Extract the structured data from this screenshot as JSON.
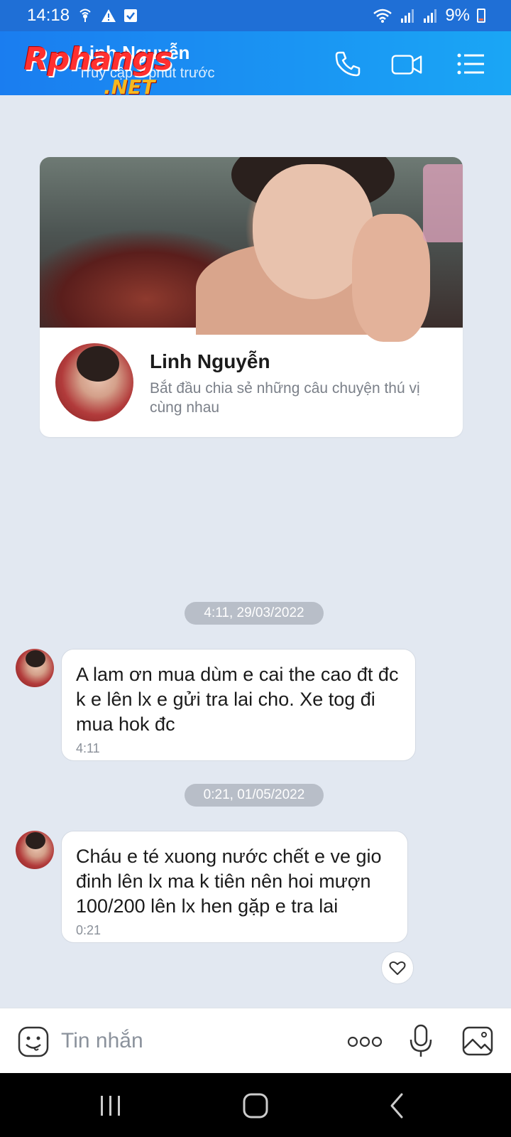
{
  "status_bar": {
    "time": "14:18",
    "battery": "9%",
    "icons": [
      "cast-icon",
      "warning-icon",
      "check-box-icon",
      "wifi-icon",
      "signal-icon",
      "signal-icon",
      "battery-icon"
    ]
  },
  "header": {
    "contact_name": "Linh Nguyễn",
    "contact_status": "Truy cập 1 phút trước",
    "watermark_main": "Rphangs",
    "watermark_net": ".NET",
    "actions": [
      "phone-icon",
      "video-call-icon",
      "menu-list-icon"
    ]
  },
  "profile_card": {
    "name": "Linh Nguyễn",
    "description": "Bắt đầu chia sẻ những câu chuyện thú vị cùng nhau"
  },
  "messages": [
    {
      "date_chip": "4:11, 29/03/2022",
      "text": "A lam ơn mua dùm e cai the cao đt đc k e lên lx e gửi tra lai cho. Xe tog đi mua hok đc",
      "time": "4:11"
    },
    {
      "date_chip": "0:21, 01/05/2022",
      "text": "Cháu e té xuong nước chết e ve gio đinh lên lx ma k tiên nên hoi mượn 100/200 lên lx hen gặp e tra lai",
      "time": "0:21"
    }
  ],
  "input_bar": {
    "placeholder": "Tin nhắn",
    "icons": [
      "emoji-icon",
      "more-options-icon",
      "microphone-icon",
      "image-icon"
    ]
  },
  "nav_bar": {
    "buttons": [
      "recent-apps-icon",
      "home-icon",
      "back-icon"
    ]
  },
  "colors": {
    "header_start": "#1a7df0",
    "header_end": "#1aa6f5",
    "status_bar": "#1f6fd6",
    "chat_background": "#e2e8f1",
    "date_chip": "#b8bec8"
  }
}
